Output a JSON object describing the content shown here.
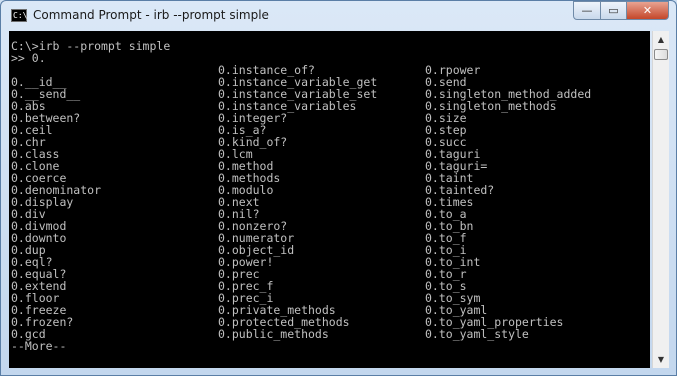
{
  "window": {
    "title": "Command Prompt - irb  --prompt simple",
    "icon_text": "C:\\",
    "controls": {
      "minimize": "—",
      "maximize": "▭",
      "close": "✕"
    }
  },
  "console": {
    "lines": [
      [
        "C:\\>irb --prompt simple",
        "",
        ""
      ],
      [
        ">> 0.",
        "",
        ""
      ],
      [
        "",
        "0.instance_of?",
        "0.rpower"
      ],
      [
        "0.__id__",
        "0.instance_variable_get",
        "0.send"
      ],
      [
        "0.__send__",
        "0.instance_variable_set",
        "0.singleton_method_added"
      ],
      [
        "0.abs",
        "0.instance_variables",
        "0.singleton_methods"
      ],
      [
        "0.between?",
        "0.integer?",
        "0.size"
      ],
      [
        "0.ceil",
        "0.is_a?",
        "0.step"
      ],
      [
        "0.chr",
        "0.kind_of?",
        "0.succ"
      ],
      [
        "0.class",
        "0.lcm",
        "0.taguri"
      ],
      [
        "0.clone",
        "0.method",
        "0.taguri="
      ],
      [
        "0.coerce",
        "0.methods",
        "0.taint"
      ],
      [
        "0.denominator",
        "0.modulo",
        "0.tainted?"
      ],
      [
        "0.display",
        "0.next",
        "0.times"
      ],
      [
        "0.div",
        "0.nil?",
        "0.to_a"
      ],
      [
        "0.divmod",
        "0.nonzero?",
        "0.to_bn"
      ],
      [
        "0.downto",
        "0.numerator",
        "0.to_f"
      ],
      [
        "0.dup",
        "0.object_id",
        "0.to_i"
      ],
      [
        "0.eql?",
        "0.power!",
        "0.to_int"
      ],
      [
        "0.equal?",
        "0.prec",
        "0.to_r"
      ],
      [
        "0.extend",
        "0.prec_f",
        "0.to_s"
      ],
      [
        "0.floor",
        "0.prec_i",
        "0.to_sym"
      ],
      [
        "0.freeze",
        "0.private_methods",
        "0.to_yaml"
      ],
      [
        "0.frozen?",
        "0.protected_methods",
        "0.to_yaml_properties"
      ],
      [
        "0.gcd",
        "0.public_methods",
        "0.to_yaml_style"
      ],
      [
        "--More--",
        "",
        ""
      ]
    ]
  },
  "scrollbar": {
    "up": "▲",
    "down": "▼"
  }
}
